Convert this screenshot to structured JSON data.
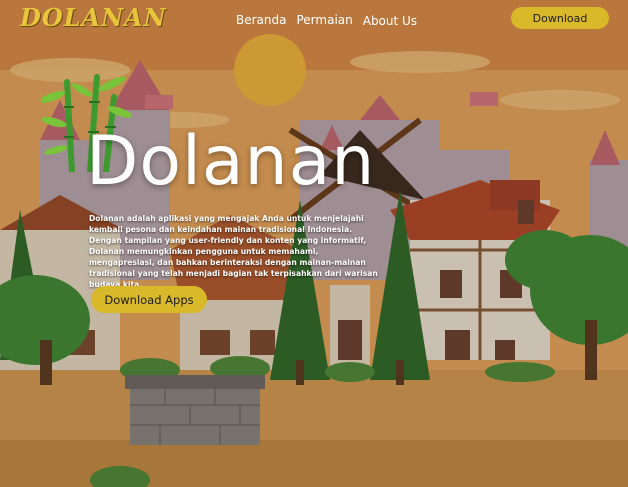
{
  "nav": {
    "brand": "DOLANAN",
    "links": [
      "Beranda",
      "Permaian",
      "About Us"
    ],
    "download_label": "Download"
  },
  "hero": {
    "title": "Dolanan",
    "description": "Dolanan adalah aplikasi yang mengajak Anda untuk menjelajahi kembali pesona dan keindahan mainan tradisional Indonesia. Dengan tampilan yang user-friendly dan konten yang informatif, Dolanan memungkinkan pengguna untuk memahami, mengapresiasi, dan bahkan berinteraksi dengan mainan-mainan tradisional yang telah menjadi bagian tak terpisahkan dari warisan budaya kita.",
    "button_label": "Download Apps"
  },
  "colors": {
    "accent": "#d9b82a",
    "brand": "#e8c53a",
    "sky": "#e3a35a"
  },
  "icons": [
    "bamboo-icon"
  ]
}
